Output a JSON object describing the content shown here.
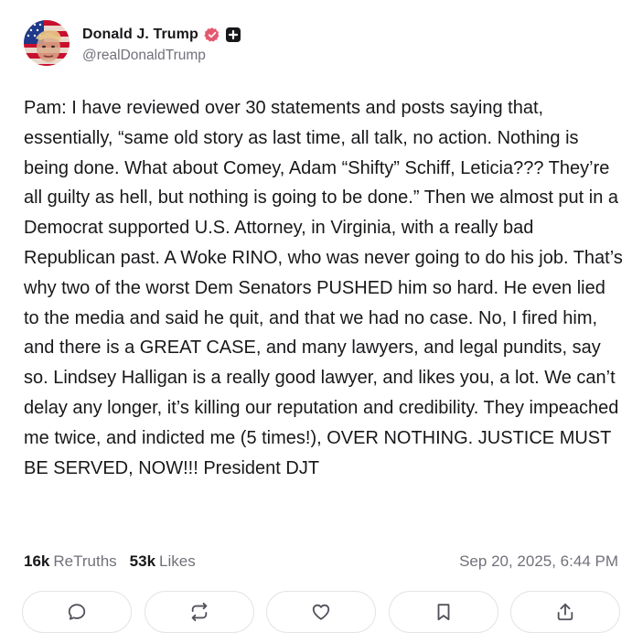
{
  "author": {
    "display_name": "Donald J. Trump",
    "handle": "@realDonaldTrump"
  },
  "post": {
    "text": "Pam: I have reviewed over 30 statements and posts saying that, essentially, “same old story as last time, all talk, no action. Nothing is being done. What about Comey, Adam “Shifty” Schiff, Leticia??? They’re all guilty as hell, but nothing is going to be done.” Then we almost put in a Democrat supported U.S. Attorney, in Virginia, with a really bad Republican past. A Woke RINO, who was never going to do his job. That’s why two of the worst Dem Senators PUSHED him so hard. He even lied to the media and said he quit, and that we had no case. No, I fired him, and there is a GREAT CASE, and many lawyers, and legal pundits, say so. Lindsey Halligan is a really good lawyer, and likes you, a lot. We can’t delay any longer, it’s killing our reputation and credibility. They impeached me twice, and indicted me (5 times!), OVER NOTHING. JUSTICE MUST BE SERVED, NOW!!! President DJT"
  },
  "stats": {
    "retruths_count": "16k",
    "retruths_label": "ReTruths",
    "likes_count": "53k",
    "likes_label": "Likes",
    "timestamp": "Sep 20, 2025, 6:44 PM"
  },
  "actions": [
    {
      "icon": "reply-icon"
    },
    {
      "icon": "retruth-icon"
    },
    {
      "icon": "heart-icon"
    },
    {
      "icon": "bookmark-icon"
    },
    {
      "icon": "share-icon"
    }
  ],
  "colors": {
    "verified": "#e4586f",
    "text": "#18181b",
    "muted": "#71717a",
    "border": "#e4e4e7"
  }
}
